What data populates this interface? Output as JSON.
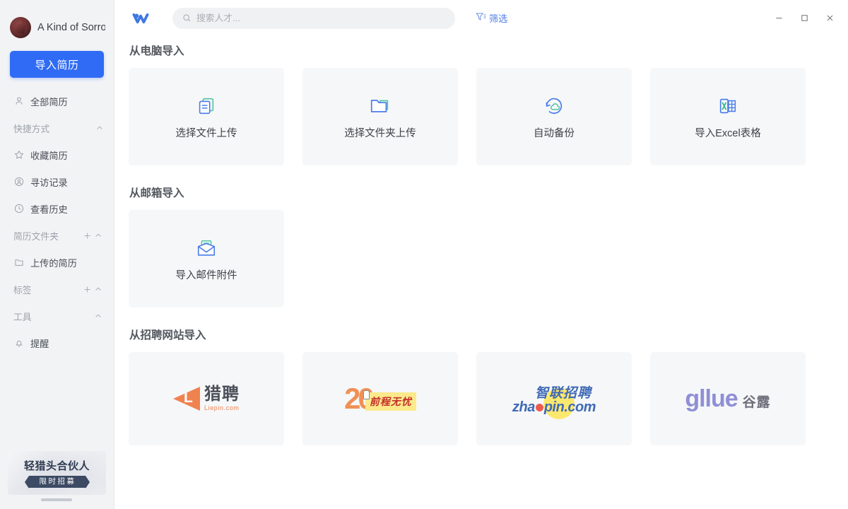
{
  "sidebar": {
    "user": {
      "name": "A Kind of Sorrow",
      "avatar_icon": "user-avatar"
    },
    "import_button": {
      "label": "导入简历"
    },
    "nav_items": [
      {
        "label": "全部简历",
        "icon": "person-icon"
      }
    ],
    "groups": [
      {
        "label": "快捷方式",
        "add": false,
        "collapse_icon": "chevron-up-icon",
        "items": [
          {
            "label": "收藏简历",
            "icon": "star-icon"
          },
          {
            "label": "寻访记录",
            "icon": "user-circle-icon"
          },
          {
            "label": "查看历史",
            "icon": "clock-icon"
          }
        ]
      },
      {
        "label": "简历文件夹",
        "add": true,
        "add_icon": "plus-icon",
        "collapse_icon": "chevron-up-icon",
        "items": [
          {
            "label": "上传的简历",
            "icon": "folder-icon"
          }
        ]
      },
      {
        "label": "标签",
        "add": true,
        "add_icon": "plus-icon",
        "collapse_icon": "chevron-up-icon",
        "items": []
      },
      {
        "label": "工具",
        "add": false,
        "collapse_icon": "chevron-up-icon",
        "items": [
          {
            "label": "提醒",
            "icon": "bell-icon"
          }
        ]
      }
    ],
    "promo": {
      "title": "轻猎头合伙人",
      "badge": "限时招募"
    }
  },
  "topbar": {
    "brand_icon": "app-logo-icon",
    "search": {
      "placeholder": "搜索人才...",
      "value": "",
      "icon": "search-icon"
    },
    "filter": {
      "label": "筛选",
      "icon": "filter-icon"
    },
    "window_controls": [
      {
        "name": "minimize",
        "glyph": "—"
      },
      {
        "name": "maximize",
        "glyph": "□"
      },
      {
        "name": "close",
        "glyph": "✕"
      }
    ]
  },
  "main": {
    "sections": [
      {
        "title": "从电脑导入",
        "cards": [
          {
            "label": "选择文件上传",
            "icon": "documents-icon"
          },
          {
            "label": "选择文件夹上传",
            "icon": "folder-open-icon"
          },
          {
            "label": "自动备份",
            "icon": "cloud-sync-icon"
          },
          {
            "label": "导入Excel表格",
            "icon": "excel-icon"
          }
        ]
      },
      {
        "title": "从邮箱导入",
        "cards": [
          {
            "label": "导入邮件附件",
            "icon": "mail-attachment-icon"
          }
        ]
      },
      {
        "title": "从招聘网站导入",
        "cards": [
          {
            "label": "猎聘",
            "sub": "Liepin.com",
            "icon": "liepin-logo"
          },
          {
            "label": "前程无忧",
            "sub": "20",
            "icon": "51job-logo"
          },
          {
            "label": "智联招聘",
            "sub": "zhaopin.com",
            "icon": "zhaopin-logo"
          },
          {
            "label": "谷露",
            "sub": "gllue",
            "icon": "gllue-logo"
          }
        ]
      }
    ]
  },
  "colors": {
    "accent": "#2f6bf5",
    "sidebar_bg": "#f2f3f5",
    "card_bg": "#f6f7f9",
    "filter_link": "#4e7de0"
  }
}
